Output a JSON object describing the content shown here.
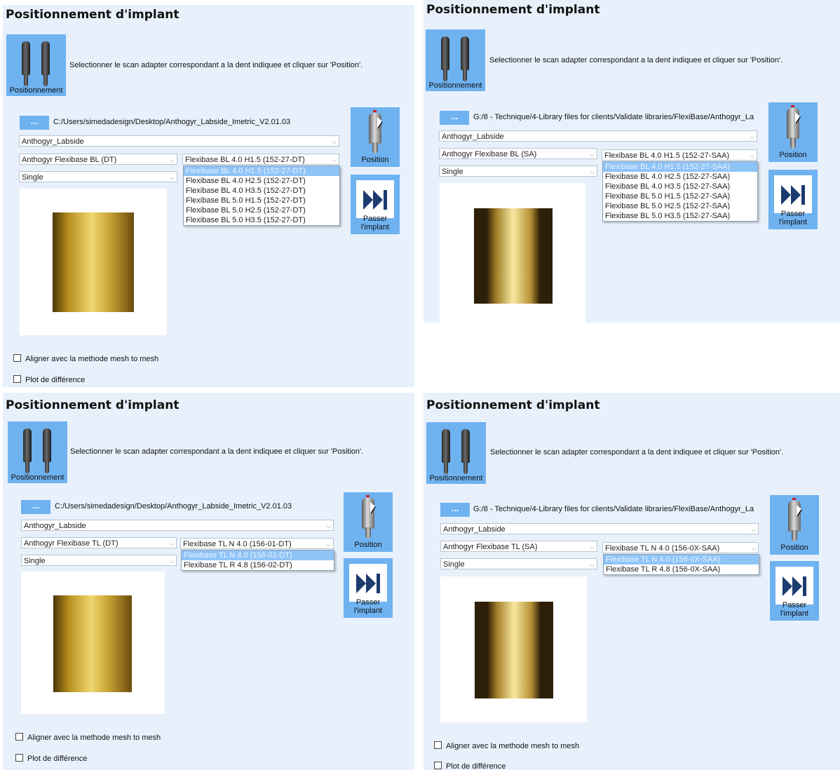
{
  "panels": [
    {
      "title": "Positionnement d'implant",
      "tool_label": "Positionnement",
      "instruction": "Selectionner le scan adapter correspondant a la dent indiquee et cliquer sur 'Position'.",
      "browse_label": "...",
      "path": "C:/Users/simedadesign/Desktop/Anthogyr_Labside_Imetric_V2.01.03",
      "library_combo": "Anthogyr_Labside",
      "family_combo": "Anthogyr Flexibase BL (DT)",
      "type_combo": "Single",
      "ref_combo": "Flexibase BL 4.0 H1.5 (152-27-DT)",
      "ref_options": [
        "Flexibase BL 4.0 H1.5 (152-27-DT)",
        "Flexibase BL 4.0 H2.5 (152-27-DT)",
        "Flexibase BL 4.0 H3.5 (152-27-DT)",
        "Flexibase BL 5.0 H1.5 (152-27-DT)",
        "Flexibase BL 5.0 H2.5 (152-27-DT)",
        "Flexibase BL 5.0 H3.5 (152-27-DT)"
      ],
      "selected_index": 0,
      "position_label": "Position",
      "skip_label": "Passer l'implant",
      "check_mesh": "Aligner avec la methode mesh to mesh",
      "check_plot": "Plot de différence"
    },
    {
      "title": "Positionnement d'implant",
      "tool_label": "Positionnement",
      "instruction": "Selectionner le scan adapter correspondant a la dent indiquee et cliquer sur 'Position'.",
      "browse_label": "...",
      "path": "G:/8 - Technique/4-Library files for clients/Validate libraries/FlexiBase/Anthogyr_La",
      "library_combo": "Anthogyr_Labside",
      "family_combo": "Anthogyr Flexibase BL (SA)",
      "type_combo": "Single",
      "ref_combo": "Flexibase BL 4.0 H1.5 (152-27-SAA)",
      "ref_options": [
        "Flexibase BL 4.0 H1.5 (152-27-SAA)",
        "Flexibase BL 4.0 H2.5 (152-27-SAA)",
        "Flexibase BL 4.0 H3.5 (152-27-SAA)",
        "Flexibase BL 5.0 H1.5 (152-27-SAA)",
        "Flexibase BL 5.0 H2.5 (152-27-SAA)",
        "Flexibase BL 5.0 H3.5 (152-27-SAA)"
      ],
      "selected_index": 0,
      "position_label": "Position",
      "skip_label": "Passer l'implant"
    },
    {
      "title": "Positionnement d'implant",
      "tool_label": "Positionnement",
      "instruction": "Selectionner le scan adapter correspondant a la dent indiquee et cliquer sur 'Position'.",
      "browse_label": "...",
      "path": "C:/Users/simedadesign/Desktop/Anthogyr_Labside_Imetric_V2.01.03",
      "library_combo": "Anthogyr_Labside",
      "family_combo": "Anthogyr Flexibase TL (DT)",
      "type_combo": "Single",
      "ref_combo": "Flexibase TL N 4.0 (156-01-DT)",
      "ref_options": [
        "Flexibase TL N 4.0 (156-01-DT)",
        "Flexibase TL R 4.8 (156-02-DT)"
      ],
      "selected_index": 0,
      "position_label": "Position",
      "skip_label": "Passer l'implant",
      "check_mesh": "Aligner avec la methode mesh to mesh",
      "check_plot": "Plot de différence"
    },
    {
      "title": "Positionnement d'implant",
      "tool_label": "Positionnement",
      "instruction": "Selectionner le scan adapter correspondant a la dent indiquee et cliquer sur 'Position'.",
      "browse_label": "...",
      "path": "G:/8 - Technique/4-Library files for clients/Validate libraries/FlexiBase/Anthogyr_La",
      "library_combo": "Anthogyr_Labside",
      "family_combo": "Anthogyr Flexibase TL (SA)",
      "type_combo": "Single",
      "ref_combo": "Flexibase TL N 4.0 (156-0X-SAA)",
      "ref_options": [
        "Flexibase TL N 4.0 (156-0X-SAA)",
        "Flexibase TL R 4.8 (156-0X-SAA)"
      ],
      "selected_index": 0,
      "position_label": "Position",
      "skip_label": "Passer l'implant",
      "check_mesh": "Aligner avec la methode mesh to mesh",
      "check_plot": "Plot de différence"
    }
  ],
  "colors": {
    "panel_bg": "#e8f1fb",
    "button_blue": "#6fb2f0",
    "selection_blue": "#8fc4f7",
    "skip_icon": "#1c3b6f"
  }
}
